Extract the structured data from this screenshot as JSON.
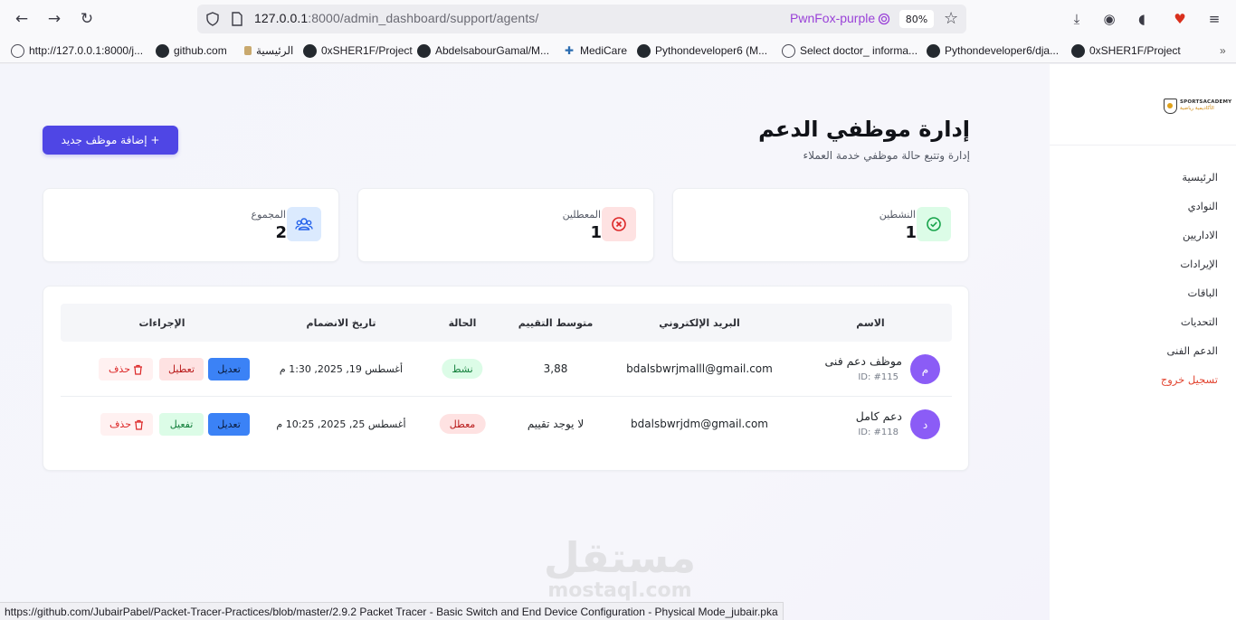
{
  "browser": {
    "url_host": "127.0.0.1",
    "url_rest": ":8000/admin_dashboard/support/agents/",
    "container": "PwnFox-purple",
    "zoom": "80%",
    "bookmarks": [
      {
        "label": "http://127.0.0.1:8000/j...",
        "icon": "globe-icon"
      },
      {
        "label": "github.com",
        "icon": "github-icon"
      },
      {
        "label": "الرئيسية",
        "icon": "page-icon"
      },
      {
        "label": "0xSHER1F/Project",
        "icon": "github-icon"
      },
      {
        "label": "AbdelsabourGamal/M...",
        "icon": "github-icon"
      },
      {
        "label": "MediCare",
        "icon": "medical-cross-icon"
      },
      {
        "label": "Pythondeveloper6 (M...",
        "icon": "github-icon"
      },
      {
        "label": "Select doctor_ informa...",
        "icon": "globe-icon"
      },
      {
        "label": "Pythondeveloper6/dja...",
        "icon": "github-icon"
      },
      {
        "label": "0xSHER1F/Project",
        "icon": "github-icon"
      }
    ],
    "status_url": "https://github.com/JubairPabel/Packet-Tracer-Practices/blob/master/2.9.2 Packet Tracer - Basic Switch and End Device Configuration - Physical Mode_jubair.pka"
  },
  "sidebar": {
    "logo_line1": "SPORTSACADEMY",
    "logo_line2": "الأكاديمية رياضية",
    "items": [
      "الرئيسية",
      "النوادي",
      "الاداريين",
      "الإيرادات",
      "الباقات",
      "التحديات",
      "الدعم الفنى"
    ],
    "logout": "تسجيل خروج"
  },
  "header": {
    "title": "إدارة موظفي الدعم",
    "subtitle": "إدارة وتتبع حالة موظفي خدمة العملاء",
    "add_button": "+ إضافة موظف جديد"
  },
  "stats": [
    {
      "label": "النشطين",
      "value": "1",
      "icon": "check-circle-icon",
      "bg": "#dcfce7",
      "fg": "#16a34a"
    },
    {
      "label": "المعطلين",
      "value": "1",
      "icon": "x-circle-icon",
      "bg": "#fee2e2",
      "fg": "#dc2626"
    },
    {
      "label": "المجموع",
      "value": "2",
      "icon": "users-icon",
      "bg": "#dbeafe",
      "fg": "#2563eb"
    }
  ],
  "table": {
    "columns": {
      "name": "الاسم",
      "email": "البريد الإلكتروني",
      "rating": "متوسط التقييم",
      "status": "الحالة",
      "joined": "تاريخ الانضمام",
      "actions": "الإجراءات"
    },
    "rows": [
      {
        "initial": "م",
        "name": "موظف دعم فنى",
        "id": "ID: #115",
        "email": "bdalsbwrjmalll@gmail.com",
        "rating": "3,88",
        "status": "نشط",
        "joined": "أغسطس 19, 2025, 1:30 م",
        "edit": "تعديل",
        "toggle": "تعطيل",
        "delete": "حذف"
      },
      {
        "initial": "د",
        "name": "دعم كامل",
        "id": "ID: #118",
        "email": "bdalsbwrjdm@gmail.com",
        "rating": "لا يوجد تقييم",
        "status": "معطل",
        "joined": "أغسطس 25, 2025, 10:25 م",
        "edit": "تعديل",
        "toggle": "تفعيل",
        "delete": "حذف"
      }
    ]
  },
  "watermark": {
    "arabic": "مستقل",
    "latin": "mostaql.com"
  },
  "colors": {
    "primary": "#4f46e5",
    "edit": "#3b82f6",
    "logout": "#e2432f"
  }
}
